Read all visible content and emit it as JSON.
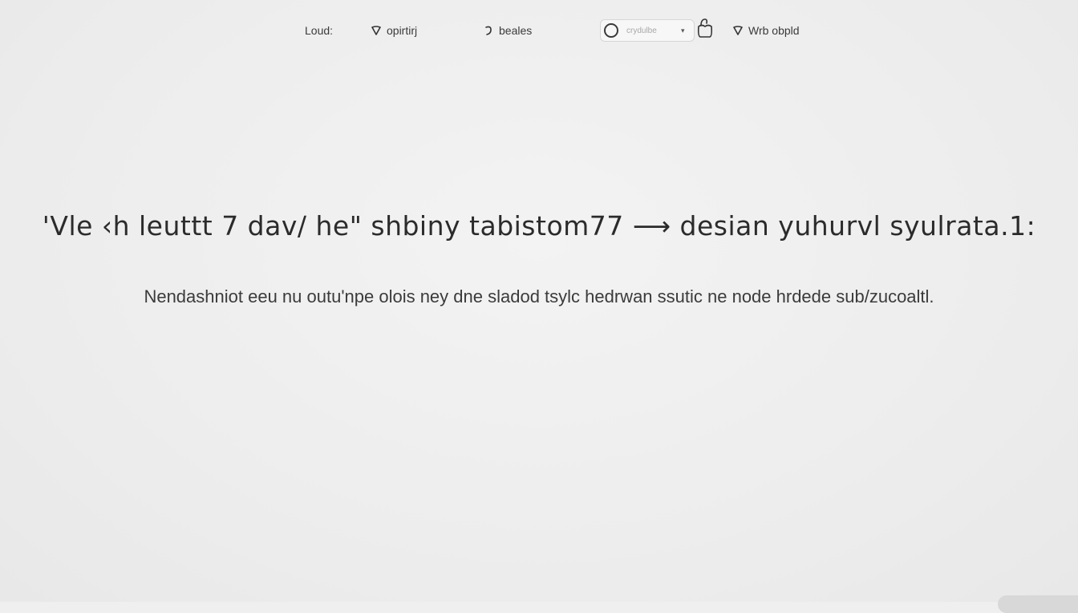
{
  "nav": {
    "load": "Loud:",
    "opinion": "opirtirj",
    "beales": "beales",
    "web": "Wrb obpld",
    "search_placeholder": "crydulbe"
  },
  "hero": {
    "headline": "'Vle  ‹h  leuttt 7  dav/  he\"  shbiny  tabistom77 ⟶  desian  yuhurvl syulrata.1:",
    "subline": "Nendashniot  eeu  nu  outu'npe olois ney dne sladod  tsylc  hedrwan  ssutic  ne  node hrdede  sub/zucoaltl."
  },
  "icons": {
    "opinion": "heart-outline-icon",
    "beales": "swirl-icon",
    "search": "circle-icon",
    "bag": "bag-icon",
    "web": "heart-outline-icon"
  }
}
